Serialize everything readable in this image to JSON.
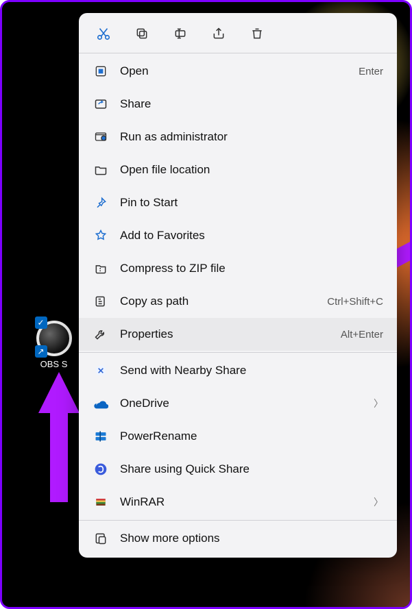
{
  "desktop": {
    "icon_label": "OBS S"
  },
  "toolbar": {
    "cut": "cut-icon",
    "copy": "copy-icon",
    "rename": "rename-icon",
    "share": "share-icon",
    "delete": "delete-icon"
  },
  "menu": {
    "open": {
      "label": "Open",
      "accel": "Enter"
    },
    "share": {
      "label": "Share"
    },
    "runadmin": {
      "label": "Run as administrator"
    },
    "openloc": {
      "label": "Open file location"
    },
    "pin": {
      "label": "Pin to Start"
    },
    "fav": {
      "label": "Add to Favorites"
    },
    "zip": {
      "label": "Compress to ZIP file"
    },
    "copypath": {
      "label": "Copy as path",
      "accel": "Ctrl+Shift+C"
    },
    "props": {
      "label": "Properties",
      "accel": "Alt+Enter"
    },
    "nearby": {
      "label": "Send with Nearby Share"
    },
    "onedrive": {
      "label": "OneDrive"
    },
    "powerrename": {
      "label": "PowerRename"
    },
    "quickshare": {
      "label": "Share using Quick Share"
    },
    "winrar": {
      "label": "WinRAR"
    },
    "more": {
      "label": "Show more options"
    }
  }
}
